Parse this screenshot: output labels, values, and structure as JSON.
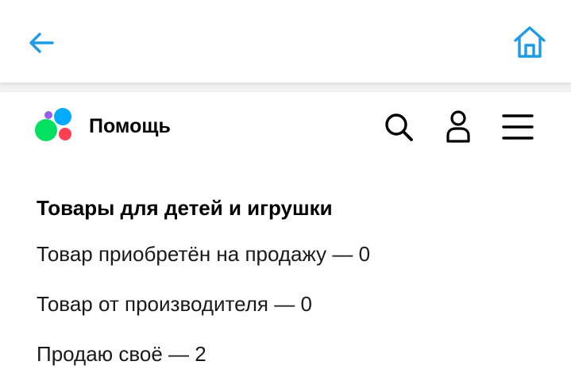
{
  "topbar": {
    "back_icon": "arrow-left-icon",
    "home_icon": "home-icon"
  },
  "header": {
    "logo_icon": "avito-logo-icon",
    "title": "Помощь",
    "search_icon": "search-icon",
    "profile_icon": "user-icon",
    "menu_icon": "hamburger-menu-icon"
  },
  "content": {
    "section_title": "Товары для детей и игрушки",
    "items": [
      {
        "label": "Товар приобретён на продажу — 0"
      },
      {
        "label": "Товар от производителя — 0"
      },
      {
        "label": "Продаю своё — 2"
      }
    ]
  },
  "colors": {
    "accent": "#1e9be5",
    "logo_purple": "#965eeb",
    "logo_blue": "#00aaff",
    "logo_green": "#04e061",
    "logo_red": "#ff4053"
  }
}
